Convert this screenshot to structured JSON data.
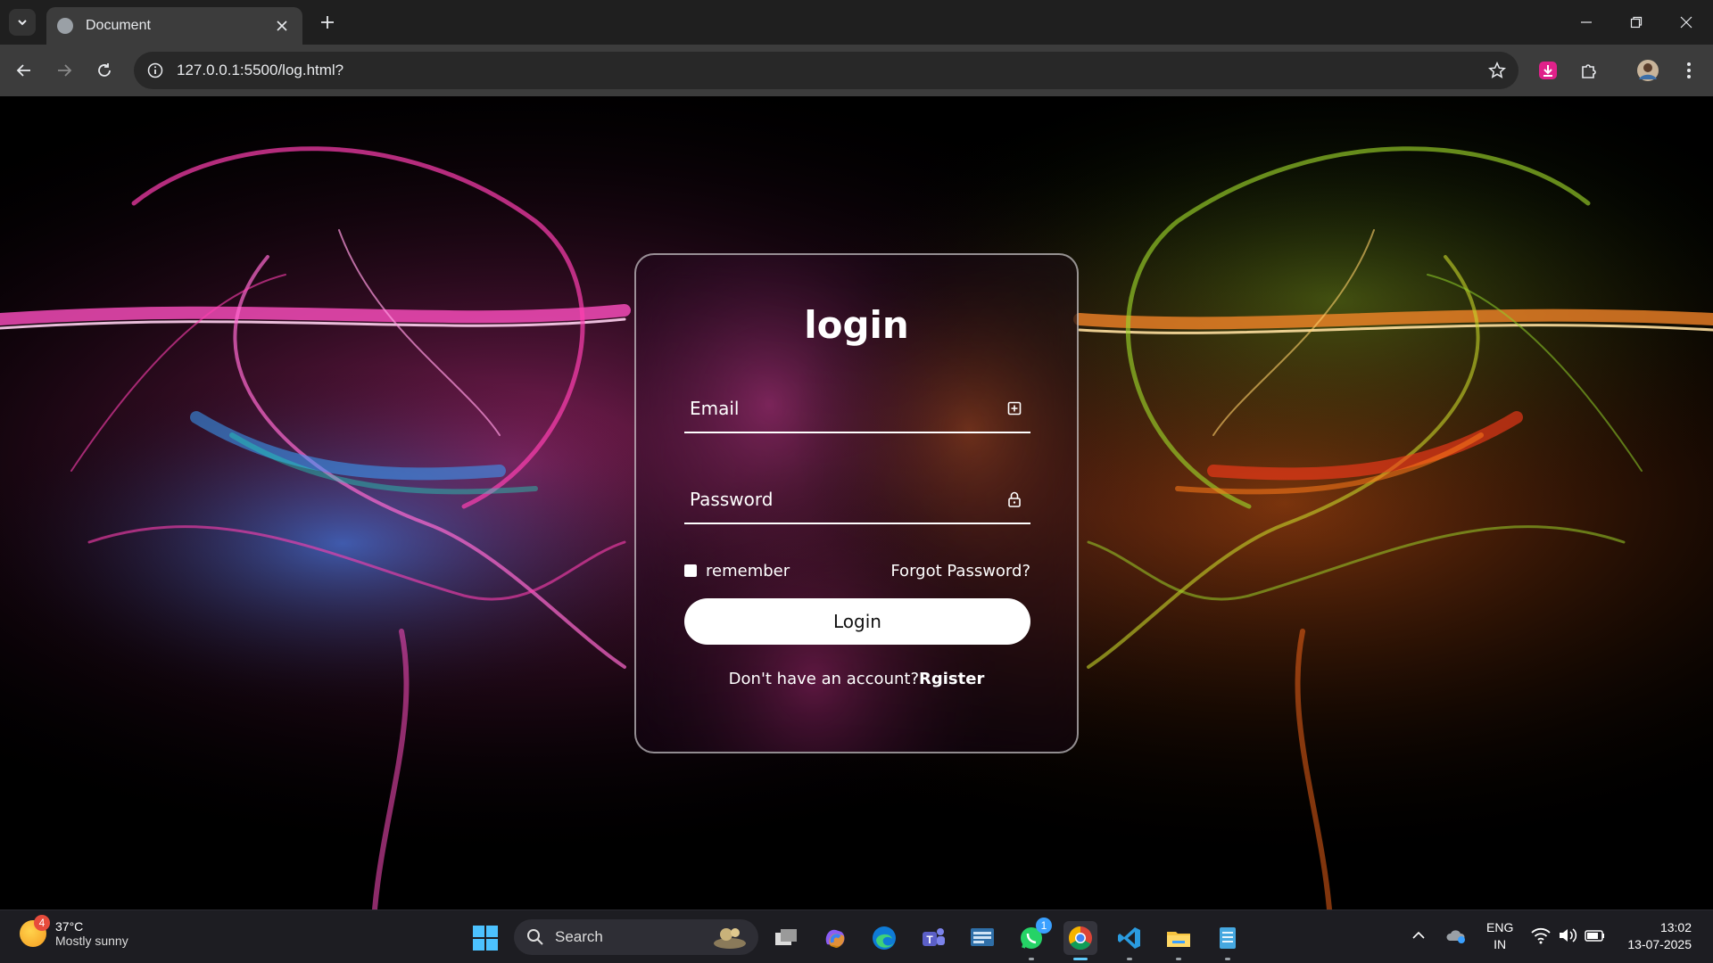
{
  "browser": {
    "tab_title": "Document",
    "url": "127.0.0.1:5500/log.html?"
  },
  "login": {
    "heading": "login",
    "email_placeholder": "Email",
    "password_placeholder": "Password",
    "remember_label": "remember",
    "forgot_link": "Forgot Password?",
    "submit_label": "Login",
    "register_prompt": "Don't have an account?",
    "register_link": "Rgister"
  },
  "taskbar": {
    "weather_temp": "37°C",
    "weather_desc": "Mostly sunny",
    "weather_badge": "4",
    "search_label": "Search",
    "whatsapp_badge": "1",
    "lang_top": "ENG",
    "lang_bottom": "IN",
    "time": "13:02",
    "date": "13-07-2025",
    "apps": [
      "task-view",
      "copilot",
      "edge",
      "teams",
      "keyboard-app",
      "whatsapp",
      "chrome",
      "vscode",
      "file-explorer",
      "notepad"
    ]
  },
  "colors": {
    "accent_pink": "#ff3fb0",
    "accent_orange": "#ff6a1a",
    "accent_green": "#8fd12a",
    "accent_blue": "#3a8bff"
  }
}
